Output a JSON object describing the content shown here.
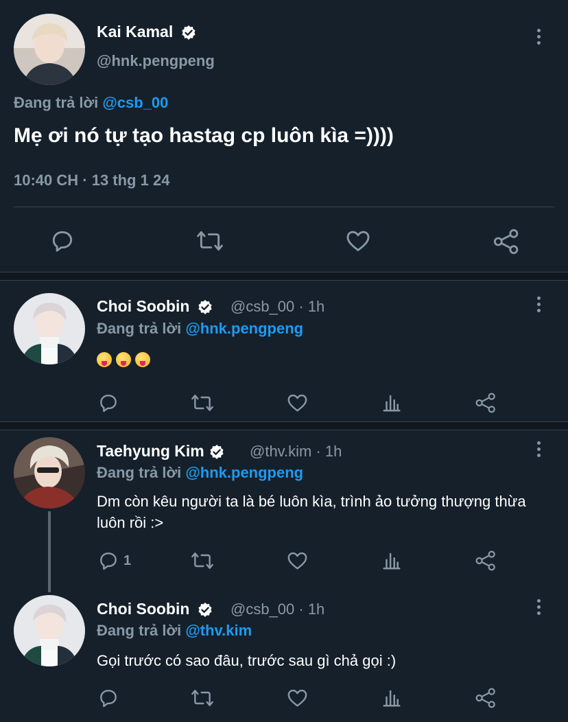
{
  "main_tweet": {
    "name": "Kai Kamal",
    "handle": "@hnk.pengpeng",
    "reply_prefix": "Đang trả lời ",
    "reply_to": "@csb_00",
    "text": "Mẹ ơi nó tự tạo hastag cp luôn kìa =))))",
    "timestamp": "10:40 CH · 13 thg 1 24"
  },
  "replies": [
    {
      "name": "Choi Soobin",
      "handle": "@csb_00 · 1h",
      "reply_prefix": "Đang trả lời ",
      "reply_to": "@hnk.pengpeng",
      "text": "😝😝😝",
      "reply_count": ""
    },
    {
      "name": "Taehyung Kim",
      "handle": "@thv.kim · 1h",
      "reply_prefix": "Đang trả lời ",
      "reply_to": "@hnk.pengpeng",
      "text": "Dm còn kêu người ta là bé luôn kìa, trình ảo tưởng thượng thừa luôn rồi :>",
      "reply_count": "1"
    },
    {
      "name": "Choi Soobin",
      "handle": "@csb_00 · 1h",
      "reply_prefix": "Đang trả lời ",
      "reply_to": "@thv.kim",
      "text": "Gọi trước có sao đâu, trước sau gì chả gọi :)",
      "reply_count": ""
    }
  ],
  "icons": {
    "reply": "reply-icon",
    "retweet": "retweet-icon",
    "like": "heart-icon",
    "share": "share-icon",
    "analytics": "analytics-icon",
    "more": "more-icon",
    "verified": "verified-badge-icon"
  },
  "colors": {
    "background": "#15202b",
    "accent": "#1d9bf0",
    "muted": "#8899a6",
    "divider": "#38444d"
  }
}
